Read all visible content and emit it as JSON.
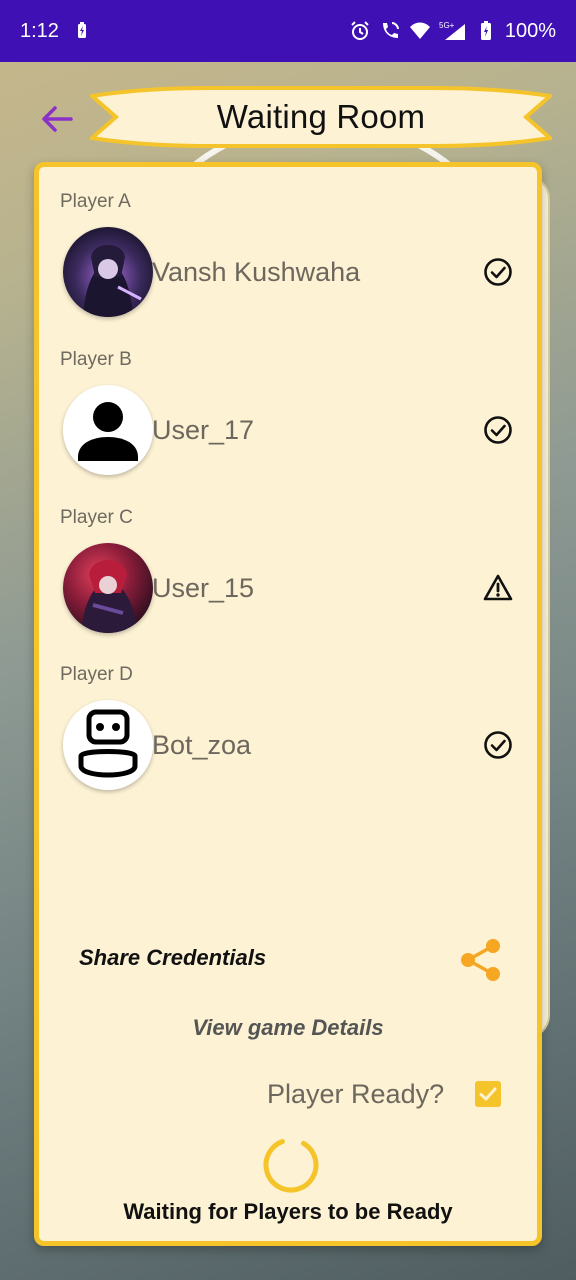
{
  "statusbar": {
    "time": "1:12",
    "battery": "100%",
    "network": "5G+"
  },
  "header": {
    "title": "Waiting Room",
    "back_icon": "arrow-left-icon"
  },
  "players": [
    {
      "label": "Player A",
      "name": "Vansh Kushwaha",
      "status": "ready"
    },
    {
      "label": "Player B",
      "name": "User_17",
      "status": "ready"
    },
    {
      "label": "Player C",
      "name": "User_15",
      "status": "warning"
    },
    {
      "label": "Player D",
      "name": "Bot_zoa",
      "status": "ready"
    }
  ],
  "actions": {
    "share_label": "Share Credentials",
    "details_label": "View game Details",
    "ready_label": "Player Ready?",
    "ready_checked": true,
    "waiting_text": "Waiting for Players to be Ready"
  },
  "colors": {
    "statusbar": "#3f10b4",
    "accent": "#f5c42a",
    "panel": "#fdf2d4",
    "back_arrow": "#8a32c8"
  }
}
